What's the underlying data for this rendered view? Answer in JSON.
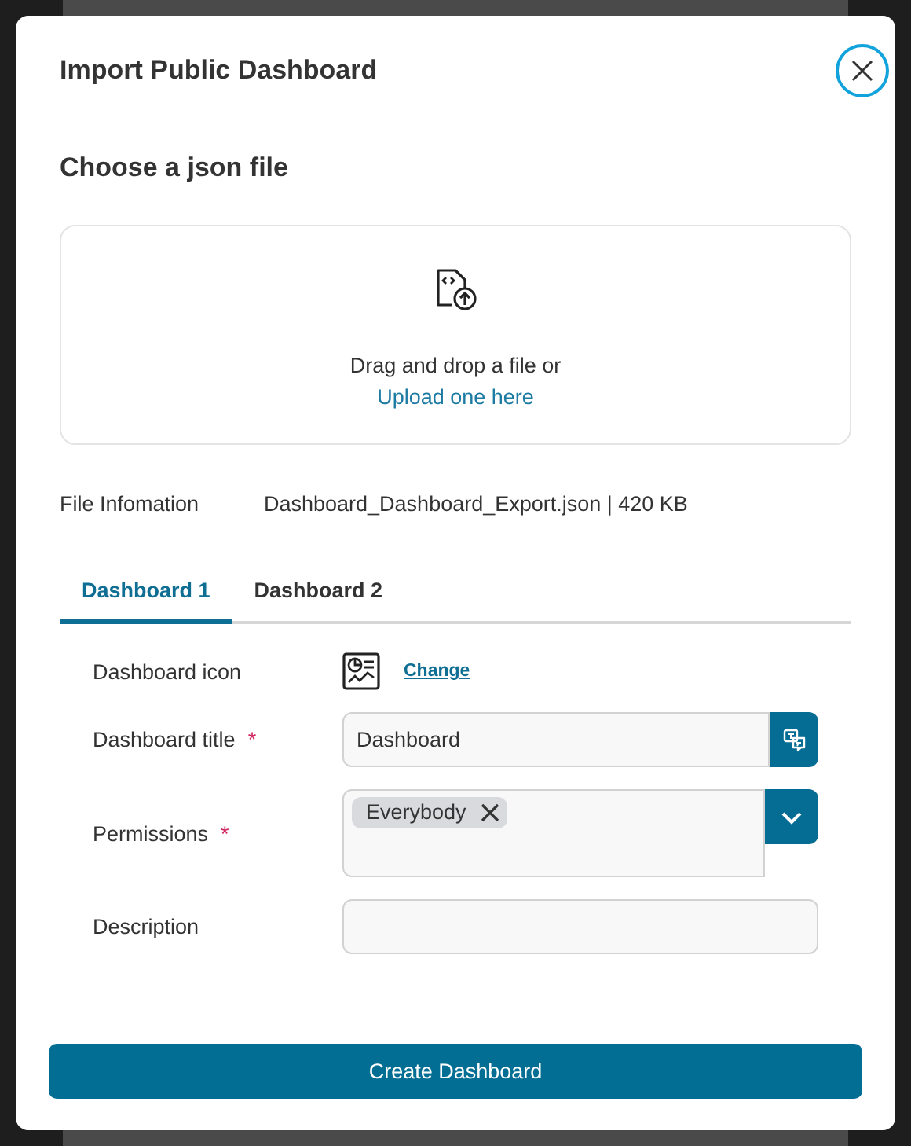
{
  "dialog": {
    "title": "Import Public Dashboard"
  },
  "upload": {
    "heading": "Choose a json file",
    "prompt": "Drag and drop a file or",
    "link": "Upload one here"
  },
  "file_info": {
    "label": "File Infomation",
    "value": "Dashboard_Dashboard_Export.json | 420 KB"
  },
  "tabs": [
    {
      "label": "Dashboard 1",
      "selected": true
    },
    {
      "label": "Dashboard 2",
      "selected": false
    }
  ],
  "fields": [
    {
      "kind": "icon",
      "label": "Dashboard icon",
      "link": "Change"
    },
    {
      "kind": "text",
      "label": "Dashboard title",
      "required_mark": "*",
      "value": "Dashboard",
      "translate_button": true
    },
    {
      "kind": "tags",
      "label": "Permissions",
      "required_mark": "*",
      "tags": [
        "Everybody"
      ]
    },
    {
      "kind": "text",
      "label": "Description",
      "translate_button": false
    }
  ],
  "primary_button": "Create Dashboard"
}
